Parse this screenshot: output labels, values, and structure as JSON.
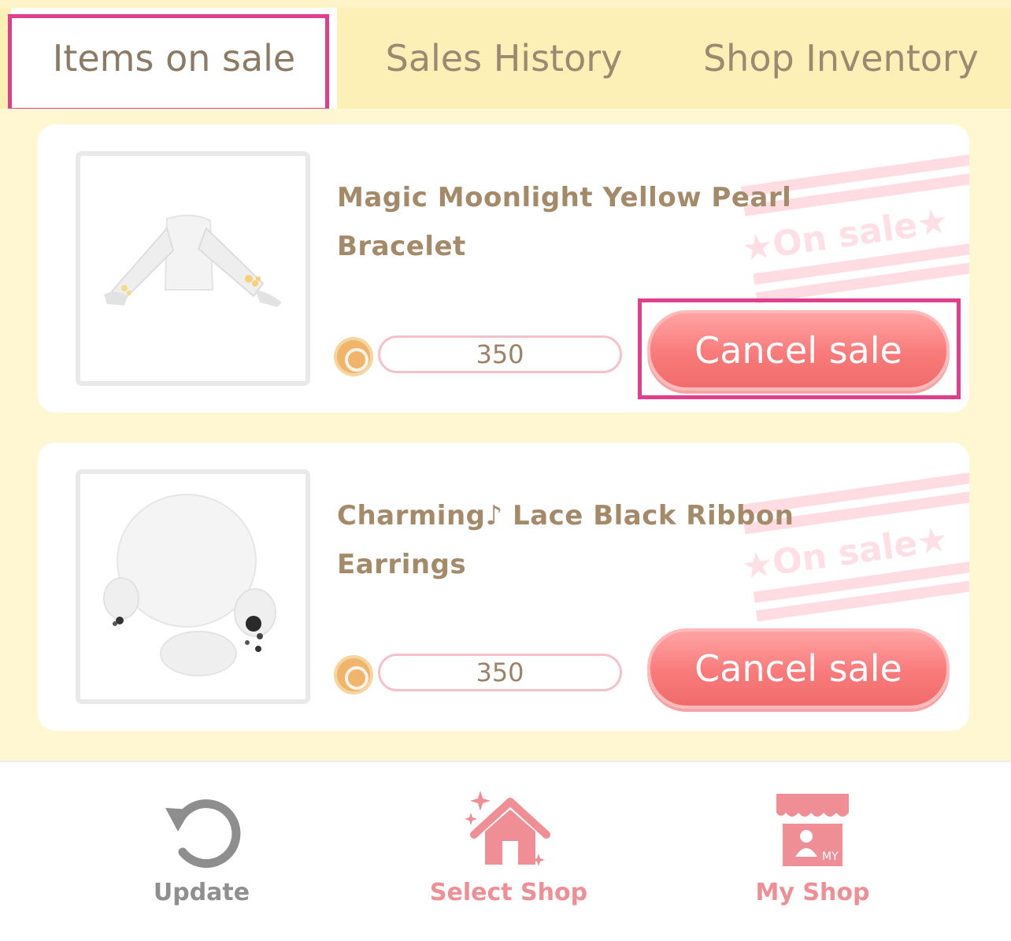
{
  "tabs": [
    {
      "label": "Items on sale",
      "active": true
    },
    {
      "label": "Sales History",
      "active": false
    },
    {
      "label": "Shop Inventory",
      "active": false
    }
  ],
  "items": [
    {
      "name_line1": "Magic Moonlight Yellow Pearl",
      "name_line2": "Bracelet",
      "price": "350",
      "status": "★On sale★",
      "cancel_label": "Cancel sale"
    },
    {
      "name_line1": "Charming♪ Lace Black Ribbon",
      "name_line2": "Earrings",
      "price": "350",
      "status": "★On sale★",
      "cancel_label": "Cancel sale"
    }
  ],
  "bottom_nav": [
    {
      "label": "Update",
      "icon": "refresh-icon"
    },
    {
      "label": "Select Shop",
      "icon": "house-sparkle-icon"
    },
    {
      "label": "My Shop",
      "icon": "storefront-icon",
      "icon_text": "MY"
    }
  ],
  "colors": {
    "accent_pink": "#f97a7a",
    "highlight_magenta": "#e23e8e",
    "tab_bg": "#fdf0b6",
    "page_bg": "#fff7d6"
  }
}
